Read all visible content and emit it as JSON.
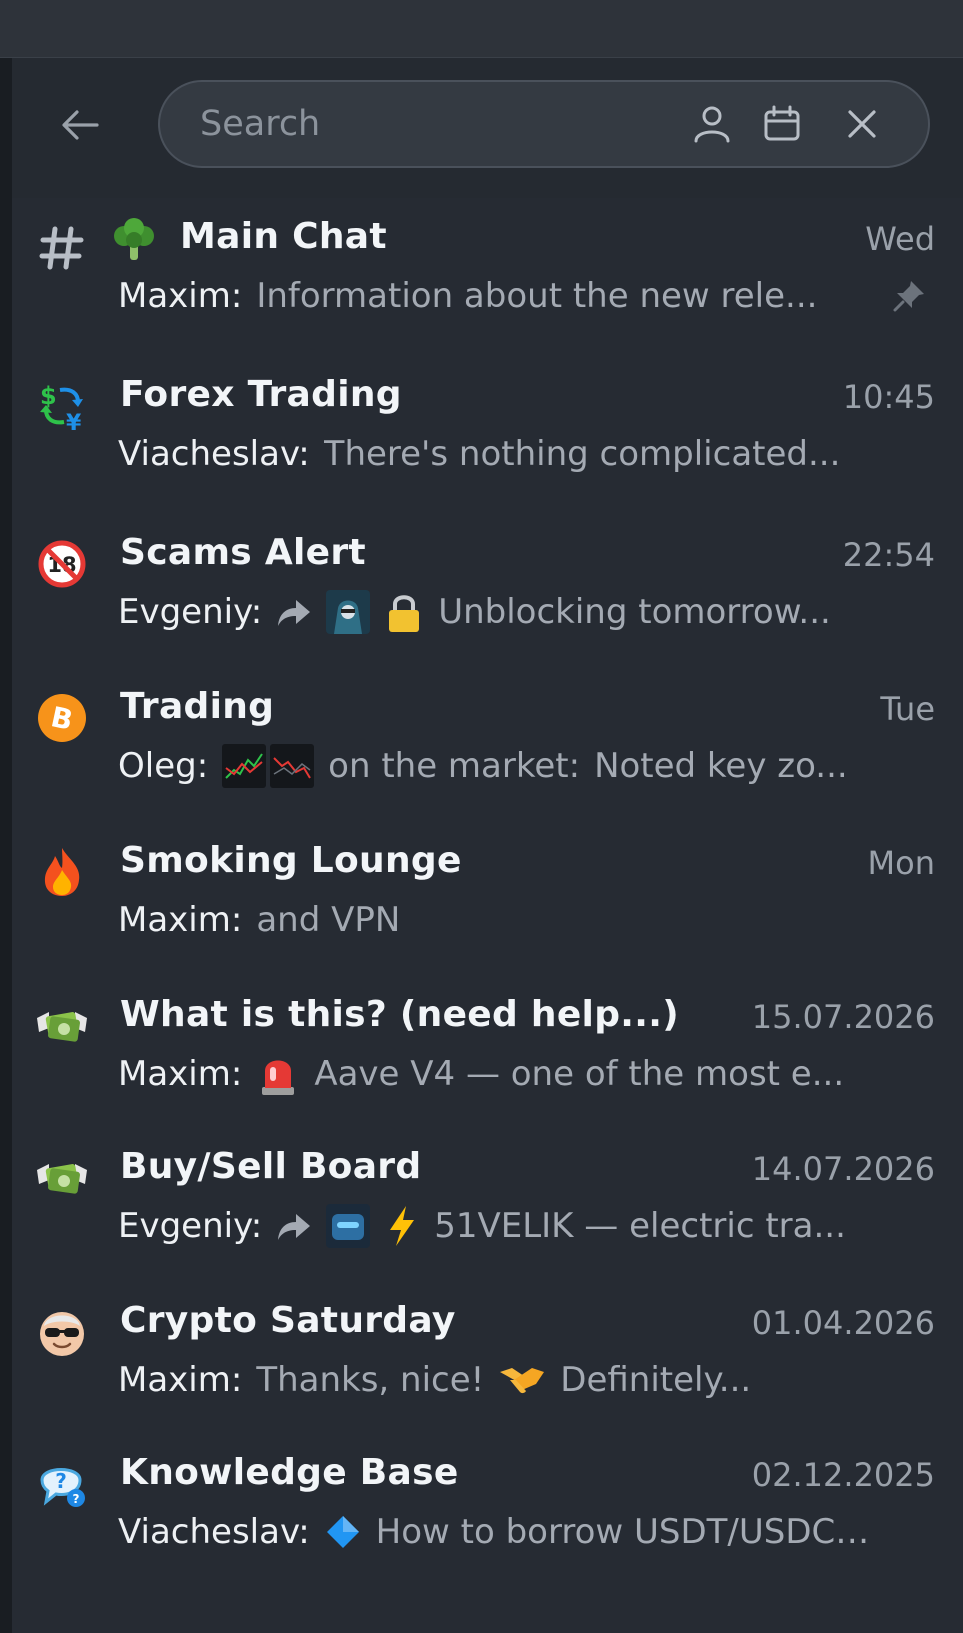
{
  "search": {
    "placeholder": "Search"
  },
  "header_icons": [
    "back-arrow-icon",
    "person-icon",
    "calendar-icon",
    "close-icon"
  ],
  "chats": [
    {
      "title": "Main Chat",
      "time": "Wed",
      "sender": "Maxim:",
      "preview": "Information about the new rele...",
      "pinned": true,
      "avatar": "hash-icon",
      "title_icon": "broccoli-icon"
    },
    {
      "title": "Forex Trading",
      "time": "10:45",
      "sender": "Viacheslav:",
      "preview": "There's nothing complicated...",
      "avatar": "currency-exchange-icon"
    },
    {
      "title": "Scams Alert",
      "time": "22:54",
      "sender": "Evgeniy:",
      "preview": "Unblocking tomorrow...",
      "avatar": "no-under-18-icon",
      "preview_icons": [
        "forward-arrow-icon",
        "hooded-figure-thumb",
        "padlock-icon"
      ]
    },
    {
      "title": "Trading",
      "time": "Tue",
      "sender": "Oleg:",
      "preview_mid": "on the market:",
      "preview": "Noted key zo...",
      "avatar": "bitcoin-icon",
      "preview_icons": [
        "chart-thumb",
        "chart-thumb"
      ]
    },
    {
      "title": "Smoking Lounge",
      "time": "Mon",
      "sender": "Maxim:",
      "preview": "and VPN",
      "avatar": "fire-icon"
    },
    {
      "title": "What is this? (need help...)",
      "time": "15.07.2026",
      "sender": "Maxim:",
      "preview": "Aave  V4  —  one  of  the most e...",
      "avatar": "money-wings-icon",
      "preview_icons": [
        "siren-icon"
      ]
    },
    {
      "title": "Buy/Sell Board",
      "time": "14.07.2026",
      "sender": "Evgeniy:",
      "preview": "51VELIK — electric tra...",
      "avatar": "money-wings-icon",
      "preview_icons": [
        "forward-arrow-icon",
        "robot-thumb",
        "lightning-icon"
      ]
    },
    {
      "title": "Crypto  Saturday",
      "time": "01.04.2026",
      "sender": "Maxim:",
      "preview_mid": "Thanks, nice!",
      "preview": "Definitely...",
      "avatar": "sunglasses-face-icon",
      "preview_icons": [
        "handshake-icon"
      ]
    },
    {
      "title": "Knowledge Base",
      "time": "02.12.2025",
      "sender": "Viacheslav:",
      "preview": "How to borrow USDT/USDC ...",
      "avatar": "question-bubble-icon",
      "preview_icons": [
        "blue-diamond-icon"
      ]
    }
  ],
  "colors": {
    "background": "#262b33",
    "header": "#252a31",
    "title": "#f2f5f8",
    "secondary_text": "#a4aab3",
    "time": "#9aa1aa"
  }
}
